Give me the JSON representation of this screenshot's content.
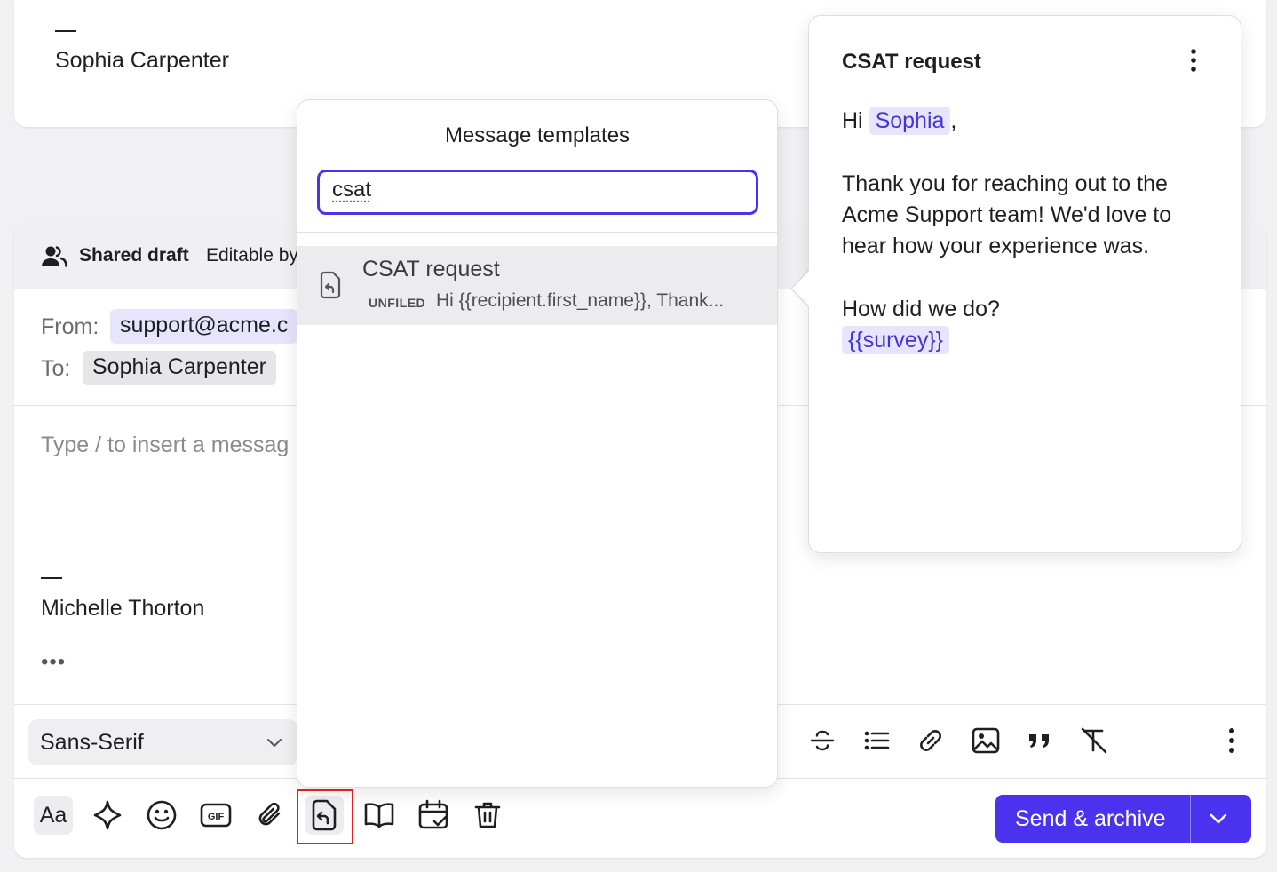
{
  "previous_message": {
    "signature_dash": "—",
    "signature_name": "Sophia Carpenter"
  },
  "composer": {
    "draft_title": "Shared draft",
    "draft_subtitle": "Editable by",
    "from_label": "From:",
    "from_value": "support@acme.c",
    "to_label": "To:",
    "to_value": "Sophia Carpenter",
    "body_placeholder": "Type / to insert a messag",
    "signature_dash": "—",
    "signature_name": "Michelle Thorton",
    "more_indicator": "•••",
    "font_select_value": "Sans-Serif",
    "aa_label": "Aa",
    "send_label": "Send & archive",
    "accent_color": "#4b32ef"
  },
  "templates_popover": {
    "title": "Message templates",
    "search_value": "csat",
    "results": [
      {
        "name": "CSAT request",
        "folder_badge": "UNFILED",
        "preview": "Hi {{recipient.first_name}}, Thank..."
      }
    ]
  },
  "template_preview": {
    "title": "CSAT request",
    "greeting_prefix": "Hi",
    "recipient_chip": "Sophia",
    "greeting_suffix": ",",
    "paragraph_1": "Thank you for reaching out to the Acme Support team! We'd love to hear how your experience was.",
    "question": "How did we do?",
    "survey_chip": "{{survey}}"
  }
}
